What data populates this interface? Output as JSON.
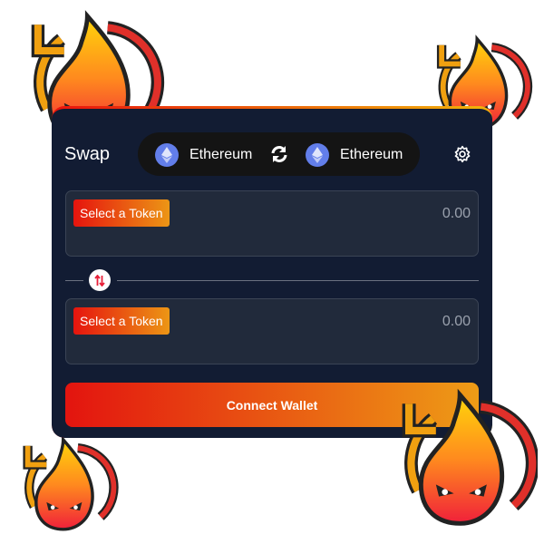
{
  "header": {
    "title": "Swap",
    "from_chain": "Ethereum",
    "to_chain": "Ethereum"
  },
  "from": {
    "select_label": "Select a Token",
    "amount": "0.00"
  },
  "to": {
    "select_label": "Select a Token",
    "amount": "0.00"
  },
  "connect_label": "Connect Wallet",
  "colors": {
    "card": "#121c33",
    "accent_start": "#e3140f",
    "accent_end": "#ee9c16"
  }
}
